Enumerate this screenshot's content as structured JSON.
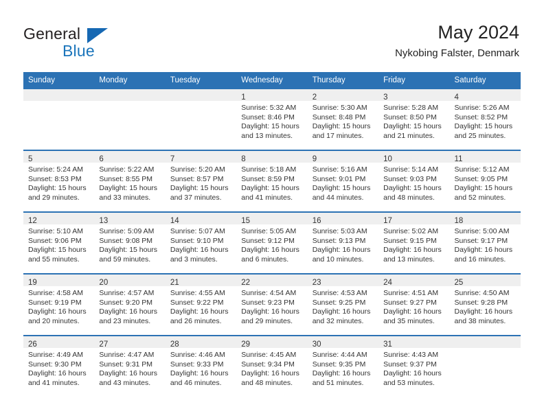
{
  "brand": {
    "name_part1": "General",
    "name_part2": "Blue",
    "colors": {
      "dark": "#231f20",
      "blue": "#1b75bb",
      "header_blue": "#2c72b4",
      "band_gray": "#efefef"
    }
  },
  "header": {
    "title": "May 2024",
    "subtitle": "Nykobing Falster, Denmark"
  },
  "weekday_headers": [
    "Sunday",
    "Monday",
    "Tuesday",
    "Wednesday",
    "Thursday",
    "Friday",
    "Saturday"
  ],
  "labels": {
    "sunrise_prefix": "Sunrise:",
    "sunset_prefix": "Sunset:",
    "daylight_prefix": "Daylight:"
  },
  "weeks": [
    [
      {
        "day": "",
        "empty": true
      },
      {
        "day": "",
        "empty": true
      },
      {
        "day": "",
        "empty": true
      },
      {
        "day": "1",
        "sunrise": "Sunrise: 5:32 AM",
        "sunset": "Sunset: 8:46 PM",
        "daylight_line1": "Daylight: 15 hours",
        "daylight_line2": "and 13 minutes."
      },
      {
        "day": "2",
        "sunrise": "Sunrise: 5:30 AM",
        "sunset": "Sunset: 8:48 PM",
        "daylight_line1": "Daylight: 15 hours",
        "daylight_line2": "and 17 minutes."
      },
      {
        "day": "3",
        "sunrise": "Sunrise: 5:28 AM",
        "sunset": "Sunset: 8:50 PM",
        "daylight_line1": "Daylight: 15 hours",
        "daylight_line2": "and 21 minutes."
      },
      {
        "day": "4",
        "sunrise": "Sunrise: 5:26 AM",
        "sunset": "Sunset: 8:52 PM",
        "daylight_line1": "Daylight: 15 hours",
        "daylight_line2": "and 25 minutes."
      }
    ],
    [
      {
        "day": "5",
        "sunrise": "Sunrise: 5:24 AM",
        "sunset": "Sunset: 8:53 PM",
        "daylight_line1": "Daylight: 15 hours",
        "daylight_line2": "and 29 minutes."
      },
      {
        "day": "6",
        "sunrise": "Sunrise: 5:22 AM",
        "sunset": "Sunset: 8:55 PM",
        "daylight_line1": "Daylight: 15 hours",
        "daylight_line2": "and 33 minutes."
      },
      {
        "day": "7",
        "sunrise": "Sunrise: 5:20 AM",
        "sunset": "Sunset: 8:57 PM",
        "daylight_line1": "Daylight: 15 hours",
        "daylight_line2": "and 37 minutes."
      },
      {
        "day": "8",
        "sunrise": "Sunrise: 5:18 AM",
        "sunset": "Sunset: 8:59 PM",
        "daylight_line1": "Daylight: 15 hours",
        "daylight_line2": "and 41 minutes."
      },
      {
        "day": "9",
        "sunrise": "Sunrise: 5:16 AM",
        "sunset": "Sunset: 9:01 PM",
        "daylight_line1": "Daylight: 15 hours",
        "daylight_line2": "and 44 minutes."
      },
      {
        "day": "10",
        "sunrise": "Sunrise: 5:14 AM",
        "sunset": "Sunset: 9:03 PM",
        "daylight_line1": "Daylight: 15 hours",
        "daylight_line2": "and 48 minutes."
      },
      {
        "day": "11",
        "sunrise": "Sunrise: 5:12 AM",
        "sunset": "Sunset: 9:05 PM",
        "daylight_line1": "Daylight: 15 hours",
        "daylight_line2": "and 52 minutes."
      }
    ],
    [
      {
        "day": "12",
        "sunrise": "Sunrise: 5:10 AM",
        "sunset": "Sunset: 9:06 PM",
        "daylight_line1": "Daylight: 15 hours",
        "daylight_line2": "and 55 minutes."
      },
      {
        "day": "13",
        "sunrise": "Sunrise: 5:09 AM",
        "sunset": "Sunset: 9:08 PM",
        "daylight_line1": "Daylight: 15 hours",
        "daylight_line2": "and 59 minutes."
      },
      {
        "day": "14",
        "sunrise": "Sunrise: 5:07 AM",
        "sunset": "Sunset: 9:10 PM",
        "daylight_line1": "Daylight: 16 hours",
        "daylight_line2": "and 3 minutes."
      },
      {
        "day": "15",
        "sunrise": "Sunrise: 5:05 AM",
        "sunset": "Sunset: 9:12 PM",
        "daylight_line1": "Daylight: 16 hours",
        "daylight_line2": "and 6 minutes."
      },
      {
        "day": "16",
        "sunrise": "Sunrise: 5:03 AM",
        "sunset": "Sunset: 9:13 PM",
        "daylight_line1": "Daylight: 16 hours",
        "daylight_line2": "and 10 minutes."
      },
      {
        "day": "17",
        "sunrise": "Sunrise: 5:02 AM",
        "sunset": "Sunset: 9:15 PM",
        "daylight_line1": "Daylight: 16 hours",
        "daylight_line2": "and 13 minutes."
      },
      {
        "day": "18",
        "sunrise": "Sunrise: 5:00 AM",
        "sunset": "Sunset: 9:17 PM",
        "daylight_line1": "Daylight: 16 hours",
        "daylight_line2": "and 16 minutes."
      }
    ],
    [
      {
        "day": "19",
        "sunrise": "Sunrise: 4:58 AM",
        "sunset": "Sunset: 9:19 PM",
        "daylight_line1": "Daylight: 16 hours",
        "daylight_line2": "and 20 minutes."
      },
      {
        "day": "20",
        "sunrise": "Sunrise: 4:57 AM",
        "sunset": "Sunset: 9:20 PM",
        "daylight_line1": "Daylight: 16 hours",
        "daylight_line2": "and 23 minutes."
      },
      {
        "day": "21",
        "sunrise": "Sunrise: 4:55 AM",
        "sunset": "Sunset: 9:22 PM",
        "daylight_line1": "Daylight: 16 hours",
        "daylight_line2": "and 26 minutes."
      },
      {
        "day": "22",
        "sunrise": "Sunrise: 4:54 AM",
        "sunset": "Sunset: 9:23 PM",
        "daylight_line1": "Daylight: 16 hours",
        "daylight_line2": "and 29 minutes."
      },
      {
        "day": "23",
        "sunrise": "Sunrise: 4:53 AM",
        "sunset": "Sunset: 9:25 PM",
        "daylight_line1": "Daylight: 16 hours",
        "daylight_line2": "and 32 minutes."
      },
      {
        "day": "24",
        "sunrise": "Sunrise: 4:51 AM",
        "sunset": "Sunset: 9:27 PM",
        "daylight_line1": "Daylight: 16 hours",
        "daylight_line2": "and 35 minutes."
      },
      {
        "day": "25",
        "sunrise": "Sunrise: 4:50 AM",
        "sunset": "Sunset: 9:28 PM",
        "daylight_line1": "Daylight: 16 hours",
        "daylight_line2": "and 38 minutes."
      }
    ],
    [
      {
        "day": "26",
        "sunrise": "Sunrise: 4:49 AM",
        "sunset": "Sunset: 9:30 PM",
        "daylight_line1": "Daylight: 16 hours",
        "daylight_line2": "and 41 minutes."
      },
      {
        "day": "27",
        "sunrise": "Sunrise: 4:47 AM",
        "sunset": "Sunset: 9:31 PM",
        "daylight_line1": "Daylight: 16 hours",
        "daylight_line2": "and 43 minutes."
      },
      {
        "day": "28",
        "sunrise": "Sunrise: 4:46 AM",
        "sunset": "Sunset: 9:33 PM",
        "daylight_line1": "Daylight: 16 hours",
        "daylight_line2": "and 46 minutes."
      },
      {
        "day": "29",
        "sunrise": "Sunrise: 4:45 AM",
        "sunset": "Sunset: 9:34 PM",
        "daylight_line1": "Daylight: 16 hours",
        "daylight_line2": "and 48 minutes."
      },
      {
        "day": "30",
        "sunrise": "Sunrise: 4:44 AM",
        "sunset": "Sunset: 9:35 PM",
        "daylight_line1": "Daylight: 16 hours",
        "daylight_line2": "and 51 minutes."
      },
      {
        "day": "31",
        "sunrise": "Sunrise: 4:43 AM",
        "sunset": "Sunset: 9:37 PM",
        "daylight_line1": "Daylight: 16 hours",
        "daylight_line2": "and 53 minutes."
      },
      {
        "day": "",
        "empty": true
      }
    ]
  ]
}
